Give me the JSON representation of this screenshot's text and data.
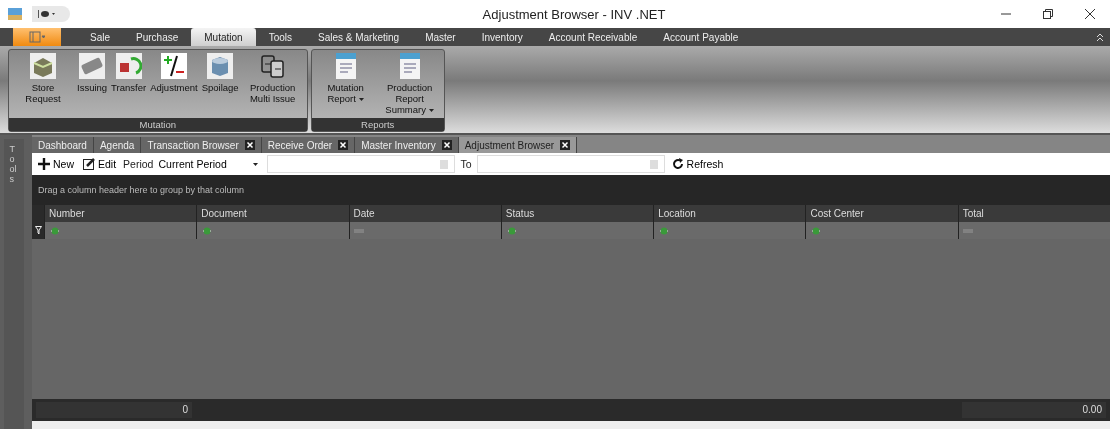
{
  "window": {
    "title": "Adjustment Browser - INV .NET"
  },
  "menu_tabs": [
    {
      "label": "Sale",
      "selected": false
    },
    {
      "label": "Purchase",
      "selected": false
    },
    {
      "label": "Mutation",
      "selected": true
    },
    {
      "label": "Tools",
      "selected": false
    },
    {
      "label": "Sales & Marketing",
      "selected": false
    },
    {
      "label": "Master",
      "selected": false
    },
    {
      "label": "Inventory",
      "selected": false
    },
    {
      "label": "Account Receivable",
      "selected": false
    },
    {
      "label": "Account Payable",
      "selected": false
    }
  ],
  "ribbon_groups": [
    {
      "title": "Mutation",
      "buttons": [
        {
          "label": "Store Request",
          "kind": "store"
        },
        {
          "label": "Issuing",
          "kind": "issuing"
        },
        {
          "label": "Transfer",
          "kind": "transfer"
        },
        {
          "label": "Adjustment",
          "kind": "adjustment"
        },
        {
          "label": "Spoilage",
          "kind": "spoilage"
        },
        {
          "label": "Production Multi Issue",
          "kind": "multi"
        }
      ]
    },
    {
      "title": "Reports",
      "buttons": [
        {
          "label": "Mutation Report",
          "kind": "report",
          "dropdown": true
        },
        {
          "label": "Production Report Summary",
          "kind": "report",
          "dropdown": true
        }
      ]
    }
  ],
  "side_panel": {
    "label": "Tools"
  },
  "doc_tabs": [
    {
      "label": "Dashboard",
      "closable": false,
      "selected": false
    },
    {
      "label": "Agenda",
      "closable": false,
      "selected": false
    },
    {
      "label": "Transaction Browser",
      "closable": true,
      "selected": false
    },
    {
      "label": "Receive Order",
      "closable": true,
      "selected": false
    },
    {
      "label": "Master Inventory",
      "closable": true,
      "selected": false
    },
    {
      "label": "Adjustment Browser",
      "closable": true,
      "selected": true
    }
  ],
  "toolbar": {
    "new": "New",
    "edit": "Edit",
    "period_label": "Period",
    "period_value": "Current Period",
    "to_label": "To",
    "refresh": "Refresh"
  },
  "grid": {
    "group_hint": "Drag a column header here to group by that column",
    "columns": [
      {
        "label": "Number",
        "kind": "text"
      },
      {
        "label": "Document",
        "kind": "text"
      },
      {
        "label": "Date",
        "kind": "equals"
      },
      {
        "label": "Status",
        "kind": "text"
      },
      {
        "label": "Location",
        "kind": "text"
      },
      {
        "label": "Cost Center",
        "kind": "text"
      },
      {
        "label": "Total",
        "kind": "equals"
      }
    ],
    "footer": {
      "count": "0",
      "total": "0.00"
    }
  }
}
